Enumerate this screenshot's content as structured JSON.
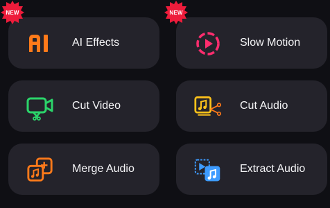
{
  "tools": [
    {
      "label": "AI Effects",
      "icon": "ai-effects-icon",
      "badge": "NEW"
    },
    {
      "label": "Slow Motion",
      "icon": "slow-motion-icon",
      "badge": "NEW"
    },
    {
      "label": "Cut Video",
      "icon": "cut-video-icon"
    },
    {
      "label": "Cut Audio",
      "icon": "cut-audio-icon"
    },
    {
      "label": "Merge Audio",
      "icon": "merge-audio-icon"
    },
    {
      "label": "Extract Audio",
      "icon": "extract-audio-icon"
    }
  ],
  "colors": {
    "background": "#0f0f14",
    "card": "#24232b",
    "badge": "#ee1c3b",
    "orange": "#ff7a1a",
    "green": "#2bd46a",
    "yellow": "#ffc21a",
    "blue": "#3d9bff",
    "pink": "#ff2d6e"
  }
}
